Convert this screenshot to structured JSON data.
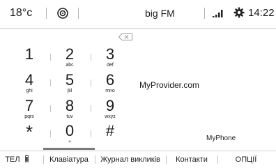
{
  "status": {
    "temperature": "18°c",
    "station": "big FM",
    "time": "14:22"
  },
  "keypad": [
    {
      "digit": "1",
      "letters": ""
    },
    {
      "digit": "2",
      "letters": "abc"
    },
    {
      "digit": "3",
      "letters": "def"
    },
    {
      "digit": "4",
      "letters": "ghi"
    },
    {
      "digit": "5",
      "letters": "jkl"
    },
    {
      "digit": "6",
      "letters": "mno"
    },
    {
      "digit": "7",
      "letters": "pqrs"
    },
    {
      "digit": "8",
      "letters": "tuv"
    },
    {
      "digit": "9",
      "letters": "wxyz"
    },
    {
      "digit": "*",
      "letters": ""
    },
    {
      "digit": "0",
      "letters": "+"
    },
    {
      "digit": "#",
      "letters": ""
    }
  ],
  "provider": "MyProvider.com",
  "device": "MyPhone",
  "tabs": {
    "phone": "ТЕЛ",
    "keypad": "Клавіатура",
    "call_log": "Журнал викликів",
    "contacts": "Контакти",
    "options": "ОПЦІЇ"
  },
  "active_tab": "keypad"
}
